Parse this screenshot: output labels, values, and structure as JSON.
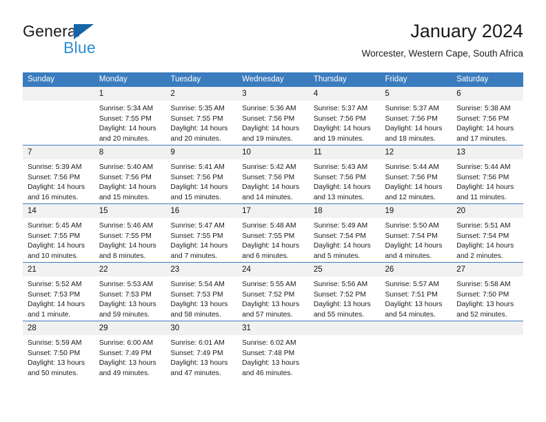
{
  "brand": {
    "name_part1": "General",
    "name_part2": "Blue",
    "accent_color": "#2e8bd4",
    "triangle_color": "#1565a8"
  },
  "header": {
    "title": "January 2024",
    "subtitle": "Worcester, Western Cape, South Africa"
  },
  "calendar": {
    "header_bg": "#3a7cbe",
    "daynum_bg": "#f1f1f1",
    "weekdays": [
      "Sunday",
      "Monday",
      "Tuesday",
      "Wednesday",
      "Thursday",
      "Friday",
      "Saturday"
    ],
    "weeks": [
      [
        {
          "day": "",
          "sunrise": "",
          "sunset": "",
          "daylight": "",
          "daylight2": ""
        },
        {
          "day": "1",
          "sunrise": "Sunrise: 5:34 AM",
          "sunset": "Sunset: 7:55 PM",
          "daylight": "Daylight: 14 hours",
          "daylight2": "and 20 minutes."
        },
        {
          "day": "2",
          "sunrise": "Sunrise: 5:35 AM",
          "sunset": "Sunset: 7:55 PM",
          "daylight": "Daylight: 14 hours",
          "daylight2": "and 20 minutes."
        },
        {
          "day": "3",
          "sunrise": "Sunrise: 5:36 AM",
          "sunset": "Sunset: 7:56 PM",
          "daylight": "Daylight: 14 hours",
          "daylight2": "and 19 minutes."
        },
        {
          "day": "4",
          "sunrise": "Sunrise: 5:37 AM",
          "sunset": "Sunset: 7:56 PM",
          "daylight": "Daylight: 14 hours",
          "daylight2": "and 19 minutes."
        },
        {
          "day": "5",
          "sunrise": "Sunrise: 5:37 AM",
          "sunset": "Sunset: 7:56 PM",
          "daylight": "Daylight: 14 hours",
          "daylight2": "and 18 minutes."
        },
        {
          "day": "6",
          "sunrise": "Sunrise: 5:38 AM",
          "sunset": "Sunset: 7:56 PM",
          "daylight": "Daylight: 14 hours",
          "daylight2": "and 17 minutes."
        }
      ],
      [
        {
          "day": "7",
          "sunrise": "Sunrise: 5:39 AM",
          "sunset": "Sunset: 7:56 PM",
          "daylight": "Daylight: 14 hours",
          "daylight2": "and 16 minutes."
        },
        {
          "day": "8",
          "sunrise": "Sunrise: 5:40 AM",
          "sunset": "Sunset: 7:56 PM",
          "daylight": "Daylight: 14 hours",
          "daylight2": "and 15 minutes."
        },
        {
          "day": "9",
          "sunrise": "Sunrise: 5:41 AM",
          "sunset": "Sunset: 7:56 PM",
          "daylight": "Daylight: 14 hours",
          "daylight2": "and 15 minutes."
        },
        {
          "day": "10",
          "sunrise": "Sunrise: 5:42 AM",
          "sunset": "Sunset: 7:56 PM",
          "daylight": "Daylight: 14 hours",
          "daylight2": "and 14 minutes."
        },
        {
          "day": "11",
          "sunrise": "Sunrise: 5:43 AM",
          "sunset": "Sunset: 7:56 PM",
          "daylight": "Daylight: 14 hours",
          "daylight2": "and 13 minutes."
        },
        {
          "day": "12",
          "sunrise": "Sunrise: 5:44 AM",
          "sunset": "Sunset: 7:56 PM",
          "daylight": "Daylight: 14 hours",
          "daylight2": "and 12 minutes."
        },
        {
          "day": "13",
          "sunrise": "Sunrise: 5:44 AM",
          "sunset": "Sunset: 7:56 PM",
          "daylight": "Daylight: 14 hours",
          "daylight2": "and 11 minutes."
        }
      ],
      [
        {
          "day": "14",
          "sunrise": "Sunrise: 5:45 AM",
          "sunset": "Sunset: 7:55 PM",
          "daylight": "Daylight: 14 hours",
          "daylight2": "and 10 minutes."
        },
        {
          "day": "15",
          "sunrise": "Sunrise: 5:46 AM",
          "sunset": "Sunset: 7:55 PM",
          "daylight": "Daylight: 14 hours",
          "daylight2": "and 8 minutes."
        },
        {
          "day": "16",
          "sunrise": "Sunrise: 5:47 AM",
          "sunset": "Sunset: 7:55 PM",
          "daylight": "Daylight: 14 hours",
          "daylight2": "and 7 minutes."
        },
        {
          "day": "17",
          "sunrise": "Sunrise: 5:48 AM",
          "sunset": "Sunset: 7:55 PM",
          "daylight": "Daylight: 14 hours",
          "daylight2": "and 6 minutes."
        },
        {
          "day": "18",
          "sunrise": "Sunrise: 5:49 AM",
          "sunset": "Sunset: 7:54 PM",
          "daylight": "Daylight: 14 hours",
          "daylight2": "and 5 minutes."
        },
        {
          "day": "19",
          "sunrise": "Sunrise: 5:50 AM",
          "sunset": "Sunset: 7:54 PM",
          "daylight": "Daylight: 14 hours",
          "daylight2": "and 4 minutes."
        },
        {
          "day": "20",
          "sunrise": "Sunrise: 5:51 AM",
          "sunset": "Sunset: 7:54 PM",
          "daylight": "Daylight: 14 hours",
          "daylight2": "and 2 minutes."
        }
      ],
      [
        {
          "day": "21",
          "sunrise": "Sunrise: 5:52 AM",
          "sunset": "Sunset: 7:53 PM",
          "daylight": "Daylight: 14 hours",
          "daylight2": "and 1 minute."
        },
        {
          "day": "22",
          "sunrise": "Sunrise: 5:53 AM",
          "sunset": "Sunset: 7:53 PM",
          "daylight": "Daylight: 13 hours",
          "daylight2": "and 59 minutes."
        },
        {
          "day": "23",
          "sunrise": "Sunrise: 5:54 AM",
          "sunset": "Sunset: 7:53 PM",
          "daylight": "Daylight: 13 hours",
          "daylight2": "and 58 minutes."
        },
        {
          "day": "24",
          "sunrise": "Sunrise: 5:55 AM",
          "sunset": "Sunset: 7:52 PM",
          "daylight": "Daylight: 13 hours",
          "daylight2": "and 57 minutes."
        },
        {
          "day": "25",
          "sunrise": "Sunrise: 5:56 AM",
          "sunset": "Sunset: 7:52 PM",
          "daylight": "Daylight: 13 hours",
          "daylight2": "and 55 minutes."
        },
        {
          "day": "26",
          "sunrise": "Sunrise: 5:57 AM",
          "sunset": "Sunset: 7:51 PM",
          "daylight": "Daylight: 13 hours",
          "daylight2": "and 54 minutes."
        },
        {
          "day": "27",
          "sunrise": "Sunrise: 5:58 AM",
          "sunset": "Sunset: 7:50 PM",
          "daylight": "Daylight: 13 hours",
          "daylight2": "and 52 minutes."
        }
      ],
      [
        {
          "day": "28",
          "sunrise": "Sunrise: 5:59 AM",
          "sunset": "Sunset: 7:50 PM",
          "daylight": "Daylight: 13 hours",
          "daylight2": "and 50 minutes."
        },
        {
          "day": "29",
          "sunrise": "Sunrise: 6:00 AM",
          "sunset": "Sunset: 7:49 PM",
          "daylight": "Daylight: 13 hours",
          "daylight2": "and 49 minutes."
        },
        {
          "day": "30",
          "sunrise": "Sunrise: 6:01 AM",
          "sunset": "Sunset: 7:49 PM",
          "daylight": "Daylight: 13 hours",
          "daylight2": "and 47 minutes."
        },
        {
          "day": "31",
          "sunrise": "Sunrise: 6:02 AM",
          "sunset": "Sunset: 7:48 PM",
          "daylight": "Daylight: 13 hours",
          "daylight2": "and 46 minutes."
        },
        {
          "day": "",
          "sunrise": "",
          "sunset": "",
          "daylight": "",
          "daylight2": ""
        },
        {
          "day": "",
          "sunrise": "",
          "sunset": "",
          "daylight": "",
          "daylight2": ""
        },
        {
          "day": "",
          "sunrise": "",
          "sunset": "",
          "daylight": "",
          "daylight2": ""
        }
      ]
    ]
  }
}
